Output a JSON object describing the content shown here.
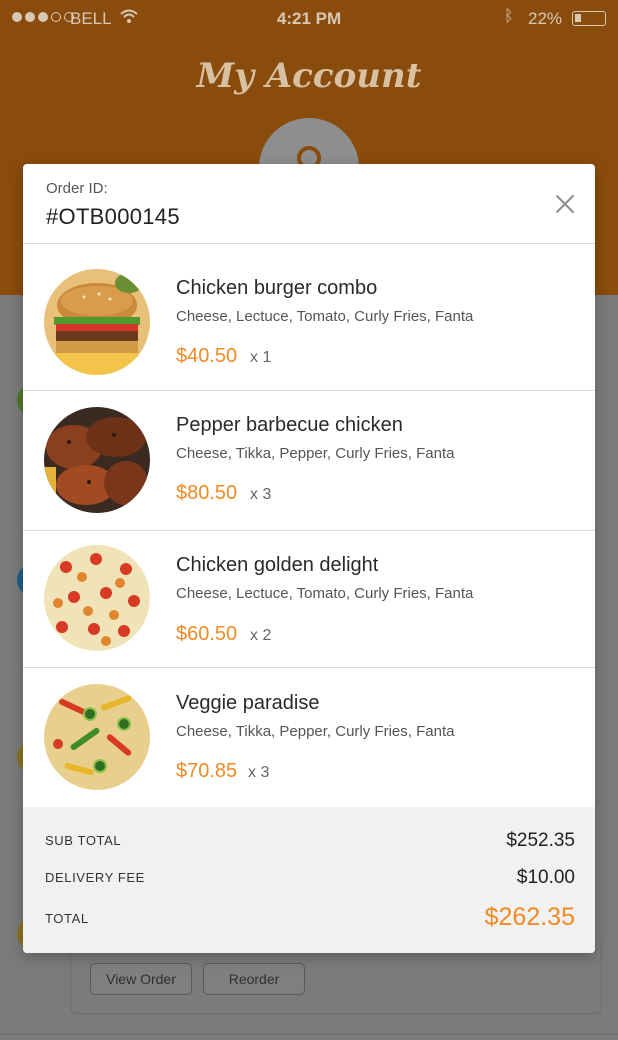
{
  "status_bar": {
    "carrier": "BELL",
    "time": "4:21 PM",
    "battery": "22%"
  },
  "header": {
    "title": "My Account"
  },
  "background_buttons": {
    "view_order": "View Order",
    "reorder": "Reorder"
  },
  "modal": {
    "order_label": "Order ID:",
    "order_id": "#OTB000145",
    "items": [
      {
        "name": "Chicken burger combo",
        "desc": "Cheese, Lectuce, Tomato, Curly Fries, Fanta",
        "price": "$40.50",
        "qty": "x 1",
        "image": "burger-image"
      },
      {
        "name": "Pepper barbecue chicken",
        "desc": "Cheese, Tikka, Pepper, Curly Fries, Fanta",
        "price": "$80.50",
        "qty": "x 3",
        "image": "bbq-chicken-image"
      },
      {
        "name": "Chicken golden delight",
        "desc": "Cheese, Lectuce, Tomato, Curly Fries, Fanta",
        "price": "$60.50",
        "qty": "x 2",
        "image": "pizza-image"
      },
      {
        "name": "Veggie paradise",
        "desc": "Cheese, Tikka, Pepper, Curly Fries, Fanta",
        "price": "$70.85",
        "qty": "x 3",
        "image": "veggie-pizza-image"
      }
    ],
    "totals": {
      "sub_total_label": "SUB TOTAL",
      "sub_total": "$252.35",
      "delivery_label": "DELIVERY FEE",
      "delivery": "$10.00",
      "total_label": "TOTAL",
      "total": "$262.35"
    }
  },
  "colors": {
    "accent": "#f08a24",
    "header_bg": "#8a4c0c"
  }
}
